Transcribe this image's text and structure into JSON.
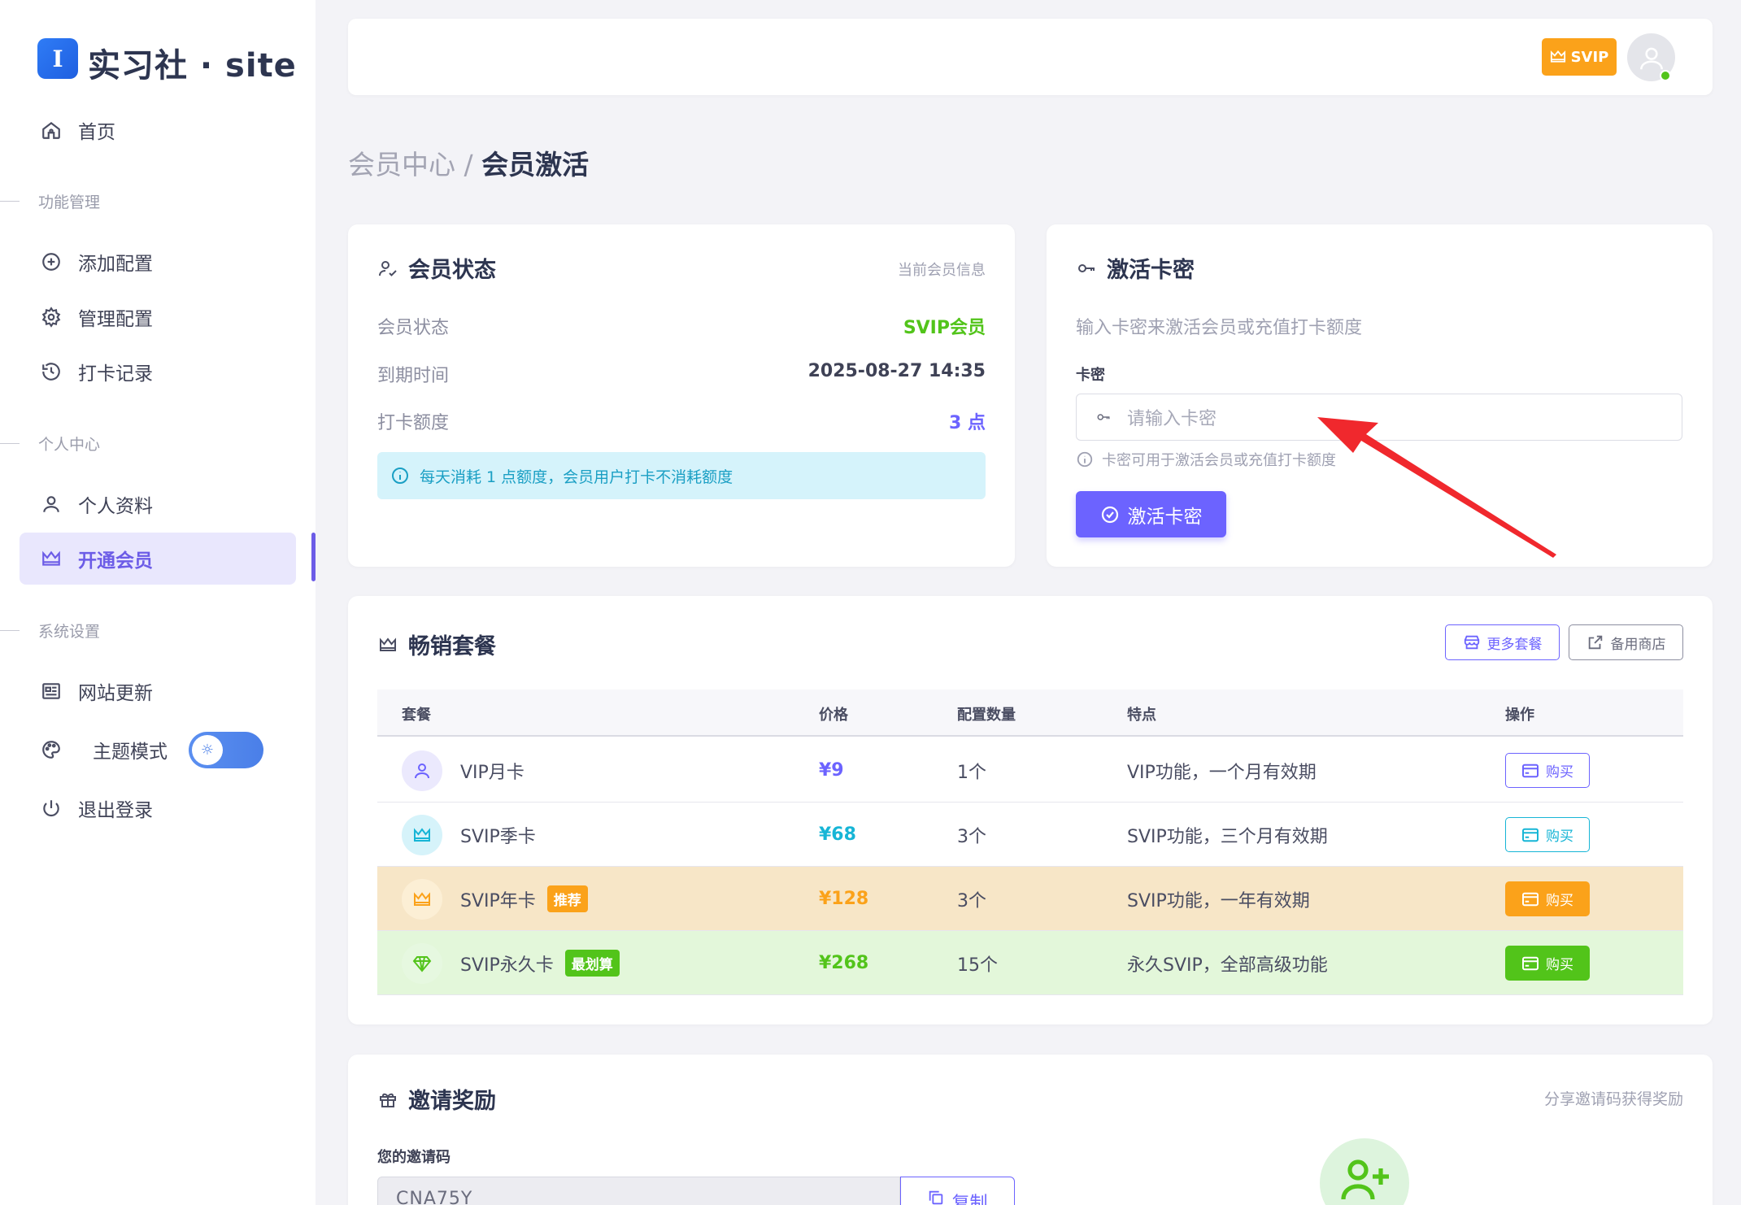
{
  "brand": {
    "logo_letter": "I",
    "name": "实习社 · site"
  },
  "sidebar": {
    "home": "首页",
    "sections": {
      "func": "功能管理",
      "personal": "个人中心",
      "system": "系统设置"
    },
    "items": {
      "add_config": "添加配置",
      "manage_config": "管理配置",
      "checkin_log": "打卡记录",
      "profile": "个人资料",
      "membership": "开通会员",
      "site_update": "网站更新",
      "theme": "主题模式",
      "logout": "退出登录"
    }
  },
  "topbar": {
    "badge": "SVIP"
  },
  "breadcrumb": {
    "parent": "会员中心",
    "sep": " / ",
    "current": "会员激活"
  },
  "member_status": {
    "title": "会员状态",
    "subtitle": "当前会员信息",
    "rows": [
      {
        "label": "会员状态",
        "value": "SVIP会员",
        "color": "#52c41a"
      },
      {
        "label": "到期时间",
        "value": "2025-08-27 14:35",
        "color": "#3f4256"
      },
      {
        "label": "打卡额度",
        "value": "3 点",
        "color": "#6c63ff"
      }
    ],
    "notice": "每天消耗 1 点额度，会员用户打卡不消耗额度"
  },
  "activate": {
    "title": "激活卡密",
    "description": "输入卡密来激活会员或充值打卡额度",
    "field_label": "卡密",
    "placeholder": "请输入卡密",
    "hint": "卡密可用于激活会员或充值打卡额度",
    "button": "激活卡密"
  },
  "plans": {
    "title": "畅销套餐",
    "more_button": "更多套餐",
    "backup_button": "备用商店",
    "headers": {
      "plan": "套餐",
      "price": "价格",
      "count": "配置数量",
      "feature": "特点",
      "action": "操作"
    },
    "rows": [
      {
        "name": "VIP月卡",
        "tag": "",
        "price": "¥9",
        "count": "1个",
        "feature": "VIP功能，一个月有效期",
        "buy": "购买",
        "accent": "#6c63ff",
        "icon_bg": "#ebe9fd",
        "row_bg": "#ffffff",
        "filled": false
      },
      {
        "name": "SVIP季卡",
        "tag": "",
        "price": "¥68",
        "count": "3个",
        "feature": "SVIP功能，三个月有效期",
        "buy": "购买",
        "accent": "#16b5d6",
        "icon_bg": "#d6f3fa",
        "row_bg": "#ffffff",
        "filled": false
      },
      {
        "name": "SVIP年卡",
        "tag": "推荐",
        "price": "¥128",
        "count": "3个",
        "feature": "SVIP功能，一年有效期",
        "buy": "购买",
        "accent": "#fba21a",
        "icon_bg": "#fcefd5",
        "row_bg": "#f7e6c7",
        "filled": true
      },
      {
        "name": "SVIP永久卡",
        "tag": "最划算",
        "price": "¥268",
        "count": "15个",
        "feature": "永久SVIP，全部高级功能",
        "buy": "购买",
        "accent": "#52c41a",
        "icon_bg": "#e6f8e0",
        "row_bg": "#e3f7da",
        "filled": true
      }
    ]
  },
  "invite": {
    "title": "邀请奖励",
    "subtitle": "分享邀请码获得奖励",
    "code_label": "您的邀请码",
    "code": "CNA75Y",
    "copy_button": "复制"
  }
}
